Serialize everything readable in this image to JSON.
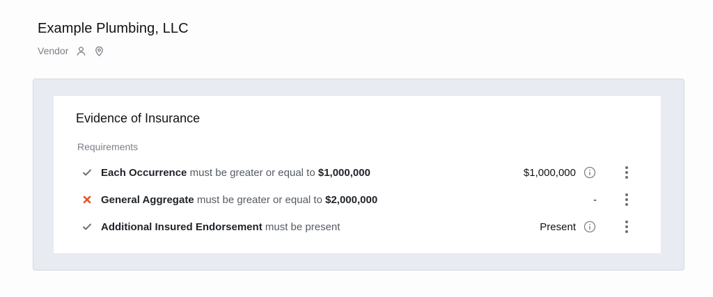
{
  "vendor": {
    "name": "Example Plumbing, LLC",
    "type": "Vendor",
    "icons": [
      "user-icon",
      "location-pin-icon"
    ]
  },
  "card": {
    "title": "Evidence of Insurance",
    "requirements_label": "Requirements"
  },
  "requirements": [
    {
      "status": "pass",
      "status_icon": "check-icon",
      "name": "Each Occurrence",
      "condition": "must be greater or equal to",
      "threshold": "$1,000,000",
      "value": "$1,000,000",
      "has_info": true
    },
    {
      "status": "fail",
      "status_icon": "x-icon",
      "name": "General Aggregate",
      "condition": "must be greater or equal to",
      "threshold": "$2,000,000",
      "value": "-",
      "has_info": false
    },
    {
      "status": "pass",
      "status_icon": "check-icon",
      "name": "Additional Insured Endorsement",
      "condition": "must be present",
      "threshold": "",
      "value": "Present",
      "has_info": true
    }
  ],
  "colors": {
    "pass": "#6b7079",
    "fail": "#e8532f",
    "panel_bg": "#e8ebf1",
    "card_bg": "#ffffff"
  }
}
